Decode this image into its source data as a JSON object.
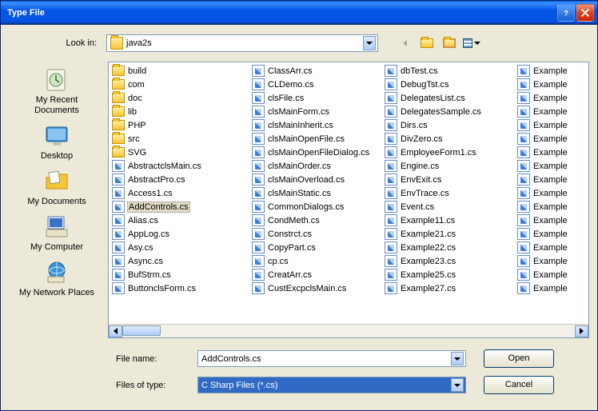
{
  "title": "Type File",
  "lookin_label": "Look in:",
  "lookin_value": "java2s",
  "places": [
    {
      "label": "My Recent Documents"
    },
    {
      "label": "Desktop"
    },
    {
      "label": "My Documents"
    },
    {
      "label": "My Computer"
    },
    {
      "label": "My Network Places"
    }
  ],
  "columns": [
    [
      {
        "name": "build",
        "type": "folder"
      },
      {
        "name": "com",
        "type": "folder"
      },
      {
        "name": "doc",
        "type": "folder"
      },
      {
        "name": "lib",
        "type": "folder"
      },
      {
        "name": "PHP",
        "type": "folder"
      },
      {
        "name": "src",
        "type": "folder"
      },
      {
        "name": "SVG",
        "type": "folder"
      },
      {
        "name": "AbstractclsMain.cs",
        "type": "cs"
      },
      {
        "name": "AbstractPro.cs",
        "type": "cs"
      },
      {
        "name": "Access1.cs",
        "type": "cs"
      },
      {
        "name": "AddControls.cs",
        "type": "cs",
        "selected": true
      },
      {
        "name": "Alias.cs",
        "type": "cs"
      },
      {
        "name": "AppLog.cs",
        "type": "cs"
      },
      {
        "name": "Asy.cs",
        "type": "cs"
      },
      {
        "name": "Async.cs",
        "type": "cs"
      },
      {
        "name": "BufStrm.cs",
        "type": "cs"
      },
      {
        "name": "ButtonclsForm.cs",
        "type": "cs"
      }
    ],
    [
      {
        "name": "ClassArr.cs",
        "type": "cs"
      },
      {
        "name": "CLDemo.cs",
        "type": "cs"
      },
      {
        "name": "clsFile.cs",
        "type": "cs"
      },
      {
        "name": "clsMainForm.cs",
        "type": "cs"
      },
      {
        "name": "clsMainInherit.cs",
        "type": "cs"
      },
      {
        "name": "clsMainOpenFile.cs",
        "type": "cs"
      },
      {
        "name": "clsMainOpenFileDialog.cs",
        "type": "cs"
      },
      {
        "name": "clsMainOrder.cs",
        "type": "cs"
      },
      {
        "name": "clsMainOverload.cs",
        "type": "cs"
      },
      {
        "name": "clsMainStatic.cs",
        "type": "cs"
      },
      {
        "name": "CommonDialogs.cs",
        "type": "cs"
      },
      {
        "name": "CondMeth.cs",
        "type": "cs"
      },
      {
        "name": "Constrct.cs",
        "type": "cs"
      },
      {
        "name": "CopyPart.cs",
        "type": "cs"
      },
      {
        "name": "cp.cs",
        "type": "cs"
      },
      {
        "name": "CreatArr.cs",
        "type": "cs"
      },
      {
        "name": "CustExcpclsMain.cs",
        "type": "cs"
      }
    ],
    [
      {
        "name": "dbTest.cs",
        "type": "cs"
      },
      {
        "name": "DebugTst.cs",
        "type": "cs"
      },
      {
        "name": "DelegatesList.cs",
        "type": "cs"
      },
      {
        "name": "DelegatesSample.cs",
        "type": "cs"
      },
      {
        "name": "Dirs.cs",
        "type": "cs"
      },
      {
        "name": "DivZero.cs",
        "type": "cs"
      },
      {
        "name": "EmployeeForm1.cs",
        "type": "cs"
      },
      {
        "name": "Engine.cs",
        "type": "cs"
      },
      {
        "name": "EnvExit.cs",
        "type": "cs"
      },
      {
        "name": "EnvTrace.cs",
        "type": "cs"
      },
      {
        "name": "Event.cs",
        "type": "cs"
      },
      {
        "name": "Example11.cs",
        "type": "cs"
      },
      {
        "name": "Example21.cs",
        "type": "cs"
      },
      {
        "name": "Example22.cs",
        "type": "cs"
      },
      {
        "name": "Example23.cs",
        "type": "cs"
      },
      {
        "name": "Example25.cs",
        "type": "cs"
      },
      {
        "name": "Example27.cs",
        "type": "cs"
      }
    ],
    [
      {
        "name": "Example",
        "type": "cs"
      },
      {
        "name": "Example",
        "type": "cs"
      },
      {
        "name": "Example",
        "type": "cs"
      },
      {
        "name": "Example",
        "type": "cs"
      },
      {
        "name": "Example",
        "type": "cs"
      },
      {
        "name": "Example",
        "type": "cs"
      },
      {
        "name": "Example",
        "type": "cs"
      },
      {
        "name": "Example",
        "type": "cs"
      },
      {
        "name": "Example",
        "type": "cs"
      },
      {
        "name": "Example",
        "type": "cs"
      },
      {
        "name": "Example",
        "type": "cs"
      },
      {
        "name": "Example",
        "type": "cs"
      },
      {
        "name": "Example",
        "type": "cs"
      },
      {
        "name": "Example",
        "type": "cs"
      },
      {
        "name": "Example",
        "type": "cs"
      },
      {
        "name": "Example",
        "type": "cs"
      },
      {
        "name": "Example",
        "type": "cs"
      }
    ]
  ],
  "filename_label": "File name:",
  "filename_value": "AddControls.cs",
  "filter_label": "Files of type:",
  "filter_value": "C Sharp Files (*.cs)",
  "open_label": "Open",
  "cancel_label": "Cancel"
}
